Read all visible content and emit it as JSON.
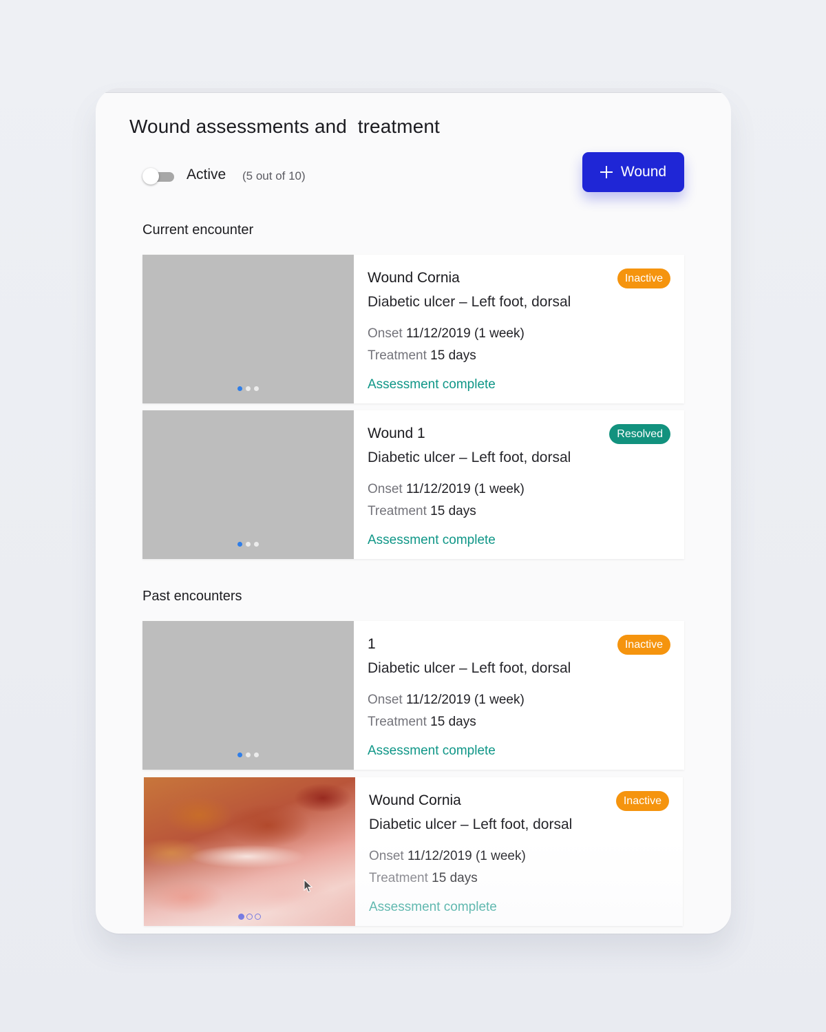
{
  "header": {
    "title": "Wound assessments and  treatment"
  },
  "filter": {
    "toggle_label": "Active",
    "count_text": "(5 out of 10)",
    "toggle_on": false
  },
  "actions": {
    "add_wound_label": "Wound",
    "accent_color": "#1f26d6"
  },
  "sections": {
    "current": {
      "title": "Current encounter",
      "cards": [
        {
          "name": "Wound Cornia",
          "diagnosis": "Diabetic ulcer – Left foot, dorsal",
          "onset_label": "Onset",
          "onset_value": "11/12/2019 (1 week)",
          "treatment_label": "Treatment",
          "treatment_value": "15 days",
          "assessment_status": "Assessment complete",
          "badge": "Inactive",
          "badge_color": "#f5940e",
          "image_count": 3,
          "active_image": 1
        },
        {
          "name": "Wound 1",
          "diagnosis": "Diabetic ulcer – Left foot, dorsal",
          "onset_label": "Onset",
          "onset_value": "11/12/2019 (1 week)",
          "treatment_label": "Treatment",
          "treatment_value": "15 days",
          "assessment_status": "Assessment complete",
          "badge": "Resolved",
          "badge_color": "#12927e",
          "image_count": 3,
          "active_image": 1
        }
      ]
    },
    "past": {
      "title": "Past encounters",
      "cards": [
        {
          "name": "1",
          "diagnosis": "Diabetic ulcer – Left foot, dorsal",
          "onset_label": "Onset",
          "onset_value": "11/12/2019 (1 week)",
          "treatment_label": "Treatment",
          "treatment_value": "15 days",
          "assessment_status": "Assessment complete",
          "badge": "Inactive",
          "badge_color": "#f5940e",
          "image_count": 3,
          "active_image": 1
        },
        {
          "name": "Wound Cornia",
          "diagnosis": "Diabetic ulcer – Left foot, dorsal",
          "onset_label": "Onset",
          "onset_value": "11/12/2019 (1 week)",
          "treatment_label": "Treatment",
          "treatment_value": "15 days",
          "assessment_status": "Assessment complete",
          "badge": "Inactive",
          "badge_color": "#f5940e",
          "image_count": 3,
          "active_image": 1
        }
      ]
    }
  },
  "colors": {
    "status_complete": "#0f9687",
    "badge_inactive": "#f5940e",
    "badge_resolved": "#12927e"
  },
  "icons": {
    "add": "plus-icon",
    "pointer": "mouse-cursor-icon"
  }
}
